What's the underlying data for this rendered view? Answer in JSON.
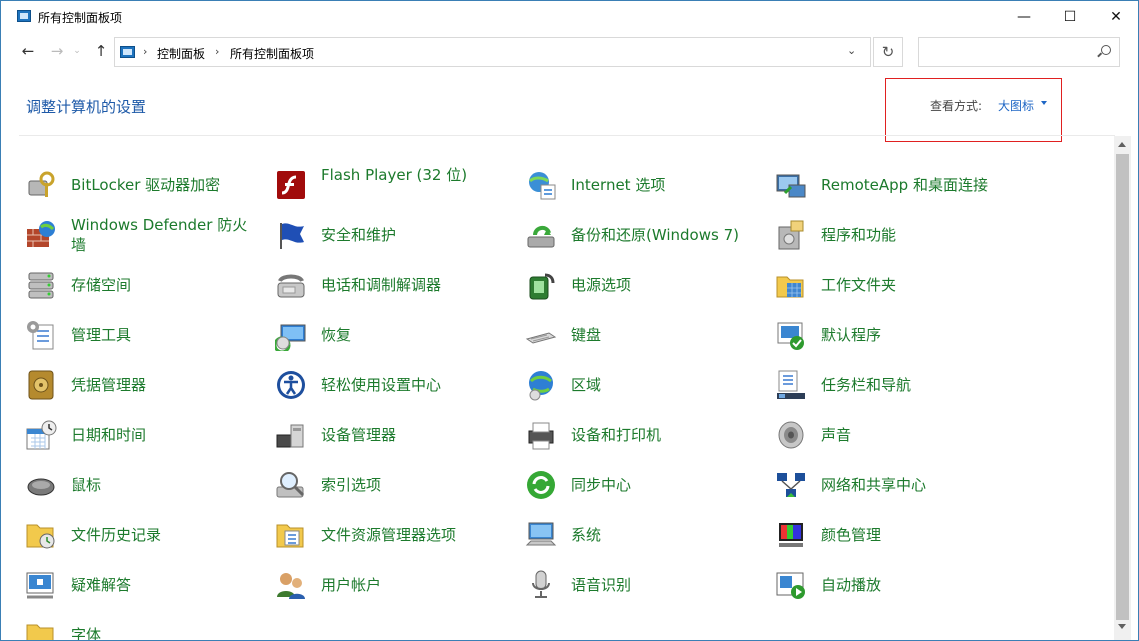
{
  "window": {
    "title": "所有控制面板项",
    "controls": {
      "minimize": "—",
      "maximize": "☐",
      "close": "✕"
    }
  },
  "nav": {
    "back": "←",
    "forward": "→",
    "history": "⌄",
    "up": "↑",
    "breadcrumb": [
      "控制面板",
      "所有控制面板项"
    ],
    "separator": "›",
    "dropdown": "⌄",
    "refresh": "↻",
    "search_placeholder": ""
  },
  "header": {
    "title": "调整计算机的设置",
    "view_by_label": "查看方式:",
    "view_by_value": "大图标"
  },
  "colors": {
    "item_text": "#1c7a2c",
    "header_text": "#1e5aa8",
    "link": "#1e66c5",
    "highlight_box": "#e02020"
  },
  "items": [
    {
      "label": "BitLocker 驱动器加密",
      "icon": "bitlocker-icon"
    },
    {
      "label": "Flash Player (32 位)",
      "icon": "flash-player-icon"
    },
    {
      "label": "Internet 选项",
      "icon": "internet-options-icon"
    },
    {
      "label": "RemoteApp 和桌面连接",
      "icon": "remoteapp-icon"
    },
    {
      "label": "Windows Defender 防火墙",
      "icon": "firewall-icon"
    },
    {
      "label": "安全和维护",
      "icon": "security-flag-icon"
    },
    {
      "label": "备份和还原(Windows 7)",
      "icon": "backup-restore-icon"
    },
    {
      "label": "程序和功能",
      "icon": "programs-icon"
    },
    {
      "label": "存储空间",
      "icon": "storage-spaces-icon"
    },
    {
      "label": "电话和调制解调器",
      "icon": "phone-modem-icon"
    },
    {
      "label": "电源选项",
      "icon": "power-options-icon"
    },
    {
      "label": "工作文件夹",
      "icon": "work-folders-icon"
    },
    {
      "label": "管理工具",
      "icon": "admin-tools-icon"
    },
    {
      "label": "恢复",
      "icon": "recovery-icon"
    },
    {
      "label": "键盘",
      "icon": "keyboard-icon"
    },
    {
      "label": "默认程序",
      "icon": "default-programs-icon"
    },
    {
      "label": "凭据管理器",
      "icon": "credential-manager-icon"
    },
    {
      "label": "轻松使用设置中心",
      "icon": "ease-of-access-icon"
    },
    {
      "label": "区域",
      "icon": "region-icon"
    },
    {
      "label": "任务栏和导航",
      "icon": "taskbar-icon"
    },
    {
      "label": "日期和时间",
      "icon": "date-time-icon"
    },
    {
      "label": "设备管理器",
      "icon": "device-manager-icon"
    },
    {
      "label": "设备和打印机",
      "icon": "devices-printers-icon"
    },
    {
      "label": "声音",
      "icon": "sound-icon"
    },
    {
      "label": "鼠标",
      "icon": "mouse-icon"
    },
    {
      "label": "索引选项",
      "icon": "indexing-icon"
    },
    {
      "label": "同步中心",
      "icon": "sync-center-icon"
    },
    {
      "label": "网络和共享中心",
      "icon": "network-icon"
    },
    {
      "label": "文件历史记录",
      "icon": "file-history-icon"
    },
    {
      "label": "文件资源管理器选项",
      "icon": "explorer-options-icon"
    },
    {
      "label": "系统",
      "icon": "system-icon"
    },
    {
      "label": "颜色管理",
      "icon": "color-management-icon"
    },
    {
      "label": "疑难解答",
      "icon": "troubleshooting-icon"
    },
    {
      "label": "用户帐户",
      "icon": "user-accounts-icon"
    },
    {
      "label": "语音识别",
      "icon": "speech-recognition-icon"
    },
    {
      "label": "自动播放",
      "icon": "autoplay-icon"
    },
    {
      "label": "字体",
      "icon": "fonts-icon"
    }
  ]
}
